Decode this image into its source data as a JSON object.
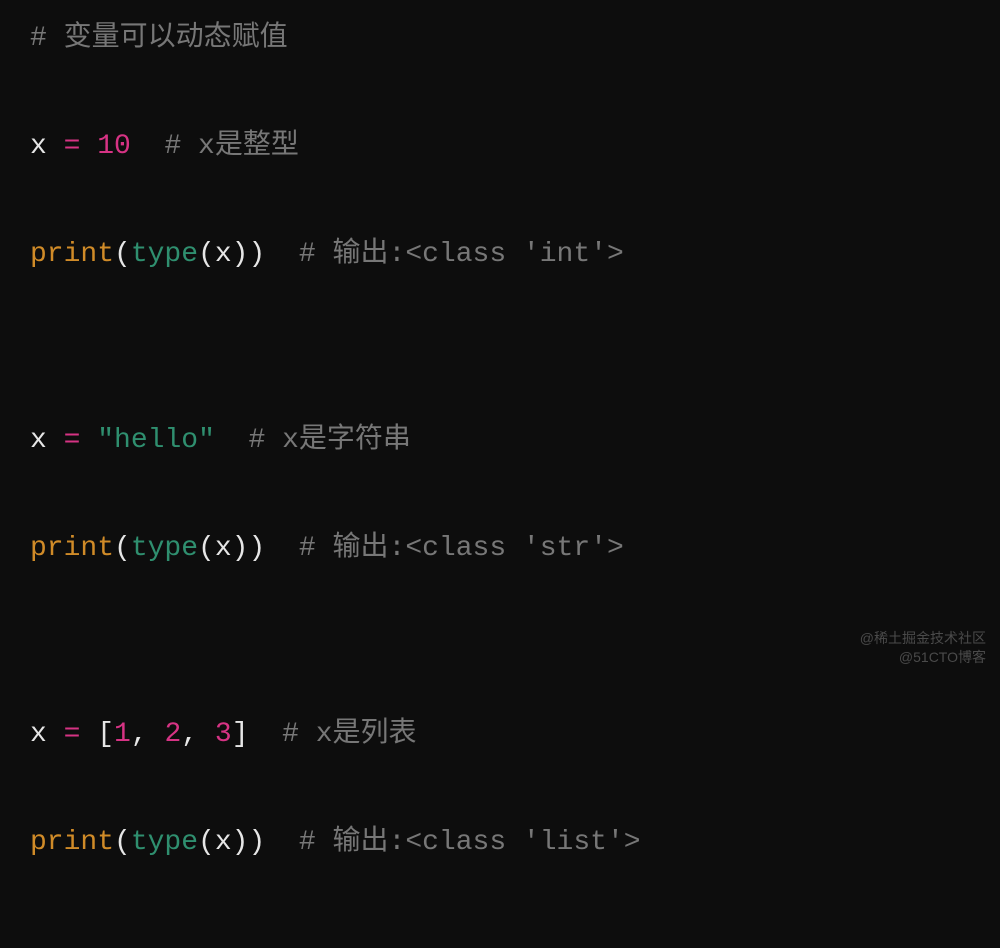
{
  "code": {
    "line1": {
      "comment": "# 变量可以动态赋值"
    },
    "line2": {
      "var": "x",
      "op": " = ",
      "num": "10",
      "sp": "  ",
      "comment": "# x是整型"
    },
    "line3": {
      "func": "print",
      "p1": "(",
      "builtin": "type",
      "p2": "(",
      "arg": "x",
      "p3": ")",
      "p4": ")",
      "sp": "  ",
      "comment": "# 输出:<class 'int'>"
    },
    "line4": {
      "var": "x",
      "op": " = ",
      "q1": "\"",
      "str": "hello",
      "q2": "\"",
      "sp": "  ",
      "comment": "# x是字符串"
    },
    "line5": {
      "func": "print",
      "p1": "(",
      "builtin": "type",
      "p2": "(",
      "arg": "x",
      "p3": ")",
      "p4": ")",
      "sp": "  ",
      "comment": "# 输出:<class 'str'>"
    },
    "line6": {
      "var": "x",
      "op": " = ",
      "b1": "[",
      "n1": "1",
      "c1": ", ",
      "n2": "2",
      "c2": ", ",
      "n3": "3",
      "b2": "]",
      "sp": "  ",
      "comment": "# x是列表"
    },
    "line7": {
      "func": "print",
      "p1": "(",
      "builtin": "type",
      "p2": "(",
      "arg": "x",
      "p3": ")",
      "p4": ")",
      "sp": "  ",
      "comment": "# 输出:<class 'list'>"
    }
  },
  "watermark": {
    "l1": "@稀土掘金技术社区",
    "l2": "@51CTO博客"
  }
}
